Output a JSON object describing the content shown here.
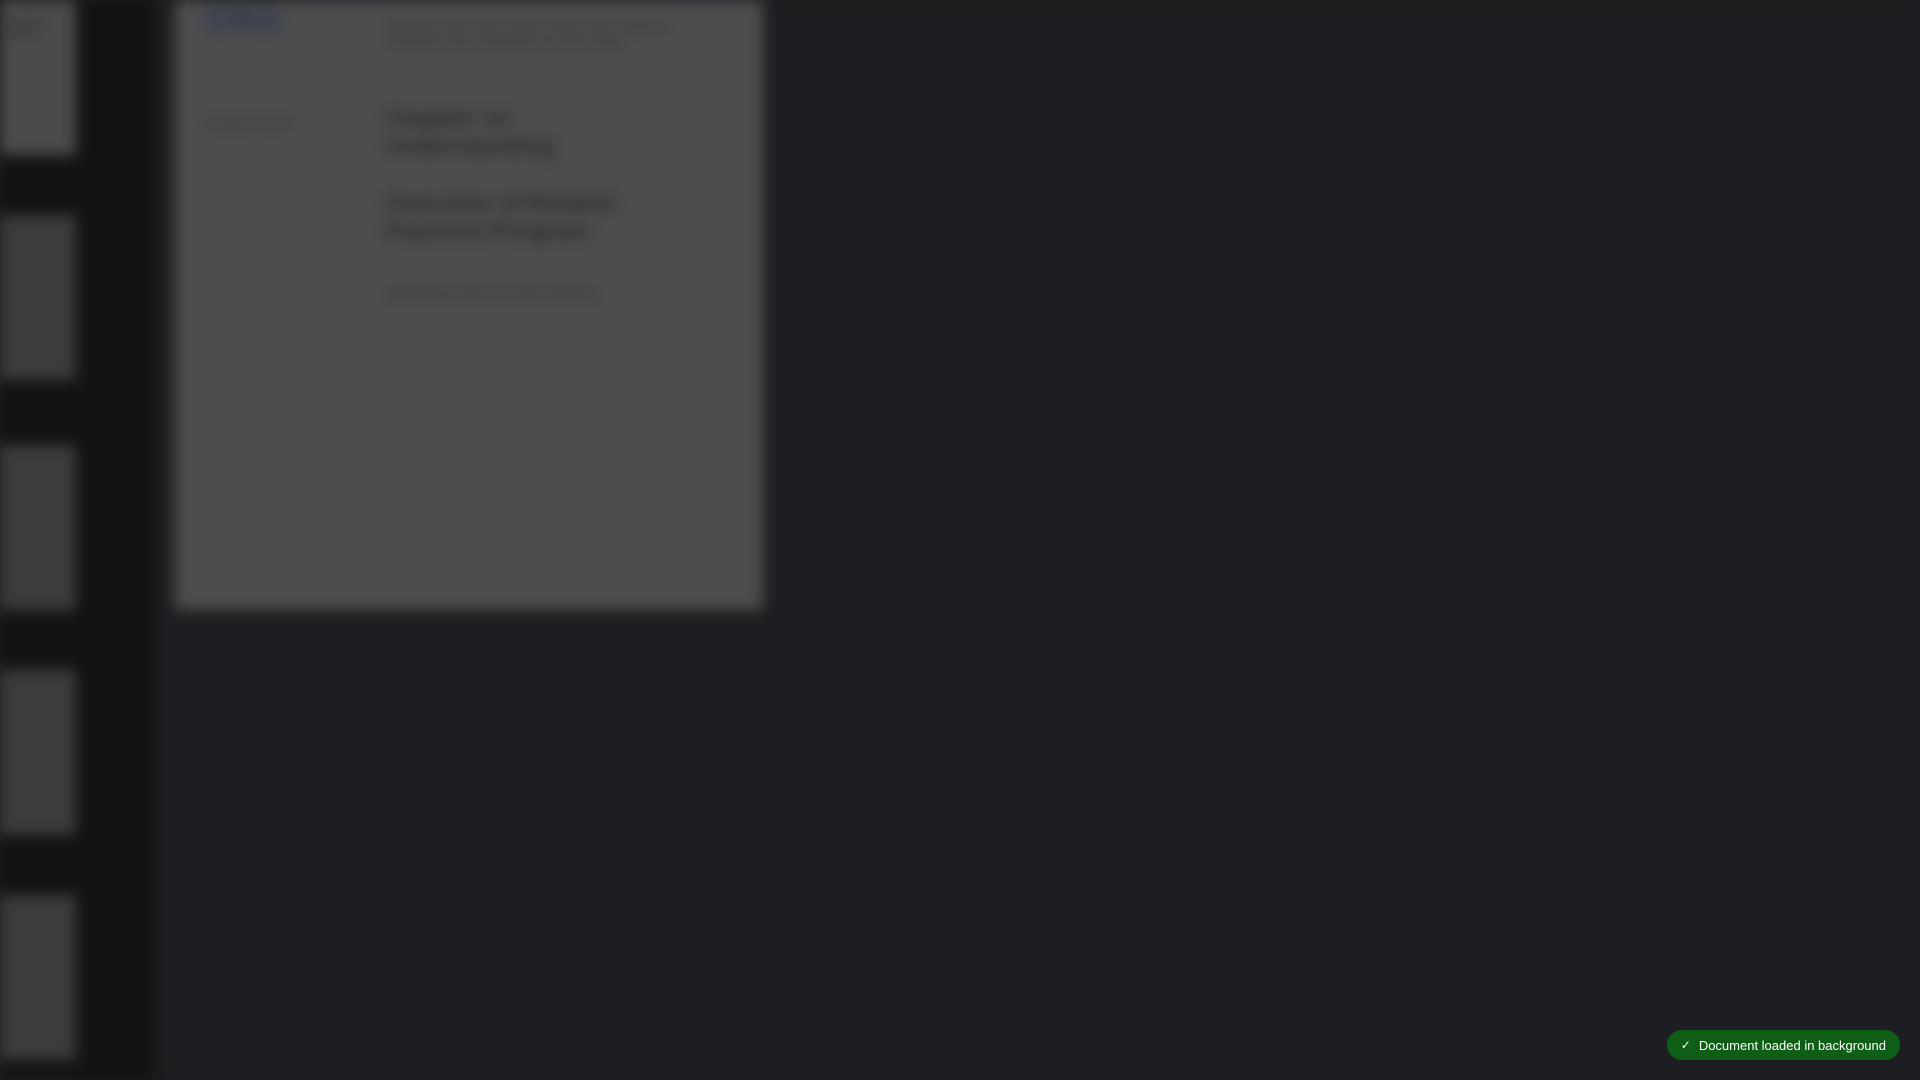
{
  "page": {
    "logo_text": "ORD",
    "top_para": "xxxxxxxx xxxx xxxxx xxxxxx xxxxx xxxx xxxxxxxx xxxxxxxxx xxxx xxxxxxxxx xxx xxxx xxxxx",
    "left_label": "xxxxxxxx xxxx x",
    "heading_1": "Chapter on Understanding",
    "heading_2": "Overview of Related Payment Program",
    "footnote": "xxxxxxxxx xxxx xx xxxx xxxxxxx"
  },
  "toast": {
    "icon": "check-icon",
    "message": "Document loaded in background",
    "color": "#0e5e16"
  }
}
